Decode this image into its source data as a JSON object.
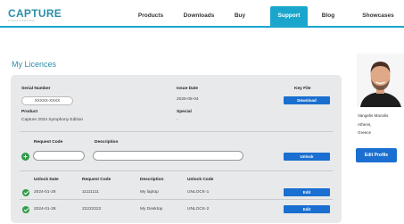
{
  "brand": {
    "name": "CAPTURE",
    "tagline": "VISUALIZATION"
  },
  "nav": [
    {
      "label": "Products"
    },
    {
      "label": "Downloads"
    },
    {
      "label": "Buy"
    },
    {
      "label": "Support",
      "active": true
    },
    {
      "label": "Blog"
    },
    {
      "label": "Showcases"
    }
  ],
  "page_title": "My Licences",
  "licence": {
    "serial_label": "Serial Number",
    "serial_value": "XXXXX-XXXX",
    "issue_label": "Issue Date",
    "issue_value": "2025-05-04",
    "keyfile_label": "Key File",
    "download_label": "Download",
    "product_label": "Product",
    "product_value": "Capture 2024 Symphony Edition",
    "special_label": "Special",
    "special_value": "-"
  },
  "unlock_form": {
    "request_code_label": "Request Code",
    "description_label": "Description",
    "unlock_button": "Unlock"
  },
  "unlocks": {
    "headers": [
      "Unlock Date",
      "Request Code",
      "Description",
      "Unlock Code"
    ],
    "rows": [
      {
        "date": "2024-01-28",
        "request_code": "11111111",
        "description": "My laptop",
        "unlock_code": "UNLOCK-1",
        "action": "Edit"
      },
      {
        "date": "2024-01-28",
        "request_code": "22222222",
        "description": "My Desktop",
        "unlock_code": "UNLOCK-2",
        "action": "Edit"
      }
    ]
  },
  "profile": {
    "name": "Vangelis Manolis",
    "city": "Athens,",
    "country": "Greece",
    "edit_button": "Edit Profile"
  },
  "colors": {
    "accent": "#1aa6cc",
    "button": "#1a6fd0",
    "success": "#2d9c46",
    "card": "#e8e9ea"
  }
}
